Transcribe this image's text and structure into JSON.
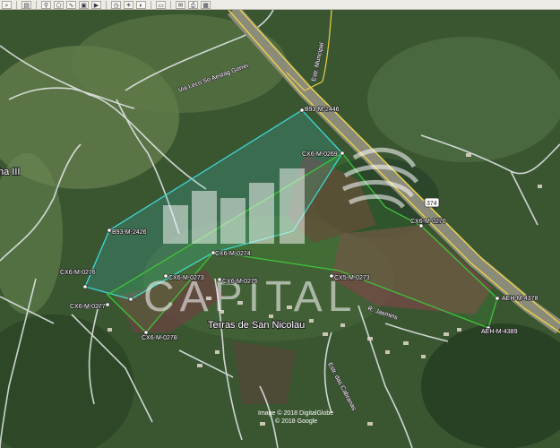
{
  "toolbar": {
    "icons": [
      "search-icon",
      "sidebar-icon",
      "placemark-icon",
      "polygon-icon",
      "path-icon",
      "overlay-icon",
      "tour-icon",
      "history-icon",
      "sun-icon",
      "planets-icon",
      "ruler-icon",
      "email-icon",
      "print-icon",
      "save-image-icon"
    ]
  },
  "map": {
    "place_name": "Terras de San Nicolau",
    "place_partial": "ha III",
    "roads": {
      "estrada_top": "Via Leco So Aestag Gorrei",
      "estrada_vertical": "Estr. Muncipal",
      "route_shield": "374",
      "road_bottom": "Estr. das Cabranas",
      "road_right": "R. Jasmins"
    },
    "markers": {
      "b93_top": "B93-M-2446",
      "cx6_0269": "CX6-M-0269",
      "b93_2426": "B93-M-2426",
      "cx6_0274": "CX6-M-0274",
      "cx6_0276": "CX6-M-0276",
      "cx6_0273a": "CX6-M-0273",
      "cx6_0275": "CX6-M-0275",
      "cx6_0277": "CX6-M-0277",
      "cx6_0278": "CX6-M-0278",
      "cx5_0273": "CX5-M-0273",
      "cx6_0270": "CX6-M-0270",
      "aeh_4378": "AEH-M-4378",
      "aeh_4389": "AEH-M-4389"
    },
    "watermark": "CAPITAL",
    "credits": [
      "Image © 2018 DigitalGlobe",
      "© 2018 Google"
    ],
    "colors": {
      "polygon_cyan": "#3fd6d8",
      "polygon_green": "#3fc43a",
      "road_yellow": "#e8d24a",
      "vegetation": "#3c5a33"
    }
  }
}
